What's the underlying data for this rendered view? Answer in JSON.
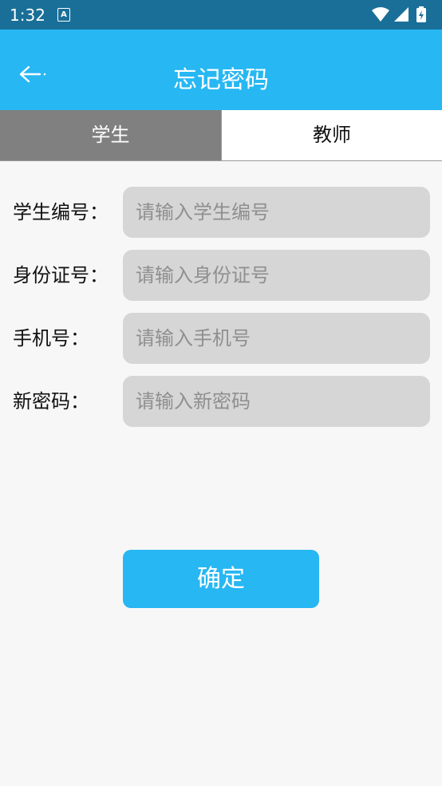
{
  "status_bar": {
    "time": "1:32",
    "notification_icon": "A",
    "icons": [
      "wifi-icon",
      "signal-icon",
      "battery-icon"
    ]
  },
  "app_bar": {
    "title": "忘记密码",
    "back_icon": "back-arrow-icon"
  },
  "tabs": [
    {
      "label": "学生",
      "selected": true
    },
    {
      "label": "教师",
      "selected": false
    }
  ],
  "form": {
    "fields": [
      {
        "label": "学生编号：",
        "placeholder": "请输入学生编号",
        "value": ""
      },
      {
        "label": "身份证号：",
        "placeholder": "请输入身份证号",
        "value": ""
      },
      {
        "label": "手机号：",
        "placeholder": "请输入手机号",
        "value": ""
      },
      {
        "label": "新密码：",
        "placeholder": "请输入新密码",
        "value": ""
      }
    ],
    "confirm_label": "确定"
  },
  "colors": {
    "status_bar": "#1a6f98",
    "accent": "#27b7f3",
    "tab_selected": "#808080",
    "input_bg": "#d6d6d6"
  }
}
